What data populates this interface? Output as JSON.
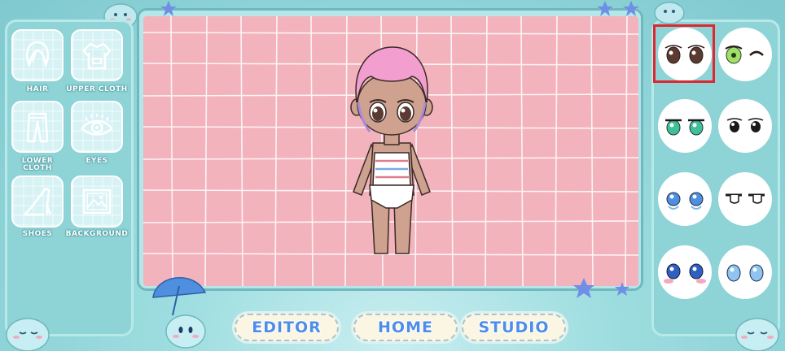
{
  "categories": [
    {
      "label": "HAIR",
      "icon": "hair-icon"
    },
    {
      "label": "UPPER CLOTH",
      "icon": "hoodie-icon"
    },
    {
      "label": "LOWER CLOTH",
      "icon": "pants-icon"
    },
    {
      "label": "EYES",
      "icon": "eye-icon"
    },
    {
      "label": "SHOES",
      "icon": "high-heel-icon"
    },
    {
      "label": "BACKGROUND",
      "icon": "picture-icon"
    }
  ],
  "lower_cloth_line1": "LOWER",
  "lower_cloth_line2": "CLOTH",
  "nav": {
    "editor": "EDITOR",
    "home": "HOME",
    "studio": "STUDIO"
  },
  "eye_options": [
    {
      "name": "brown-round-eyes",
      "selected": true
    },
    {
      "name": "green-wink-eyes",
      "selected": false
    },
    {
      "name": "teal-sparkle-eyes",
      "selected": false
    },
    {
      "name": "black-simple-eyes",
      "selected": false
    },
    {
      "name": "blue-teary-eyes",
      "selected": false
    },
    {
      "name": "flat-line-eyes",
      "selected": false
    },
    {
      "name": "blue-blush-eyes",
      "selected": false
    },
    {
      "name": "light-blue-eyes",
      "selected": false
    }
  ],
  "colors": {
    "canvas": "#f2b3bc",
    "panel": "#8ed3d6",
    "selection": "#e0262e",
    "nav_text": "#4f8ee8",
    "hair": "#f29fd0"
  }
}
